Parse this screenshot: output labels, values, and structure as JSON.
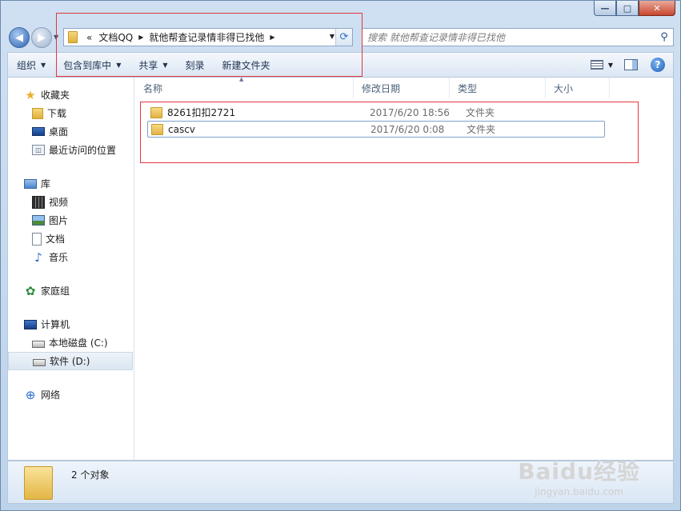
{
  "window": {
    "minimize_glyph": "—",
    "maximize_glyph": "□",
    "close_glyph": "✕"
  },
  "address": {
    "overflow_label": "«",
    "crumbs": [
      "文档QQ",
      "就他帮查记录情非得已找他"
    ],
    "search_placeholder": "搜索 就他帮查记录情非得已找他"
  },
  "toolbar": {
    "items": [
      "组织",
      "包含到库中",
      "共享",
      "刻录",
      "新建文件夹"
    ]
  },
  "nav": {
    "favorites_title": "收藏夹",
    "favorites": [
      "下载",
      "桌面",
      "最近访问的位置"
    ],
    "libraries_title": "库",
    "libraries": [
      "视频",
      "图片",
      "文档",
      "音乐"
    ],
    "homegroup_title": "家庭组",
    "computer_title": "计算机",
    "drives": [
      "本地磁盘 (C:)",
      "软件 (D:)"
    ],
    "network_title": "网络"
  },
  "columns": {
    "name": "名称",
    "date": "修改日期",
    "type": "类型",
    "size": "大小"
  },
  "files": [
    {
      "name": "8261扣扣2721",
      "date": "2017/6/20 18:56",
      "type": "文件夹"
    },
    {
      "name": "cascv",
      "date": "2017/6/20 0:08",
      "type": "文件夹"
    }
  ],
  "details": {
    "count_text": "2 个对象"
  },
  "watermark": {
    "logo": "Baidu经验",
    "url": "jingyan.baidu.com"
  },
  "colors": {
    "annotation": "#e2363f",
    "accent": "#2c62b0"
  }
}
